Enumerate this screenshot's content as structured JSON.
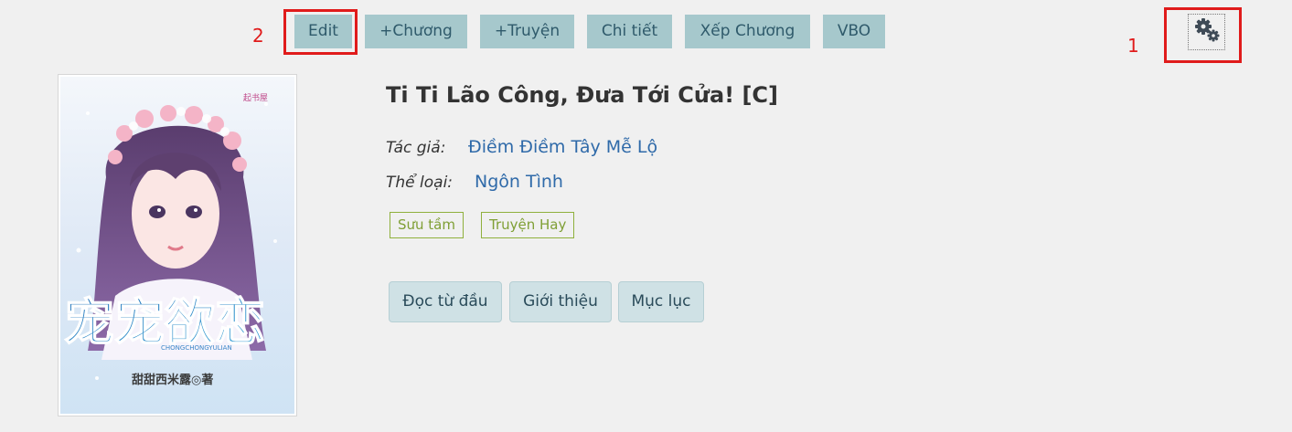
{
  "toolbar": {
    "edit_label": "Edit",
    "add_chapter_label": "+Chương",
    "add_story_label": "+Truyện",
    "details_label": "Chi tiết",
    "sort_chapters_label": "Xếp Chương",
    "vbo_label": "VBO"
  },
  "annotations": {
    "settings_number": "1",
    "edit_number": "2"
  },
  "icons": {
    "settings": "gears-icon"
  },
  "cover": {
    "publisher_logo_text": "起书屋",
    "title_art_text": "宠宠欲恋",
    "romanized_text": "CHONGCHONGYULIAN",
    "author_text": "甜甜西米露◎著"
  },
  "book": {
    "title": "Ti Ti Lão Công, Đưa Tới Cửa! [C]",
    "author_label": "Tác giả:",
    "author_name": "Điềm Điềm Tây Mễ Lộ",
    "genre_label": "Thể loại:",
    "genre_name": "Ngôn Tình",
    "tags": [
      "Sưu tầm",
      "Truyện Hay"
    ]
  },
  "actions": {
    "read_from_start": "Đọc từ đầu",
    "introduction": "Giới thiệu",
    "table_of_contents": "Mục lục"
  },
  "colors": {
    "page_background": "#f0f0f0",
    "toolbar_button": "#a6c8cc",
    "annotation_red": "#e01b1b",
    "link_blue": "#2f6aa9",
    "tag_green": "#7f9f35",
    "action_button": "#cfe1e5"
  }
}
